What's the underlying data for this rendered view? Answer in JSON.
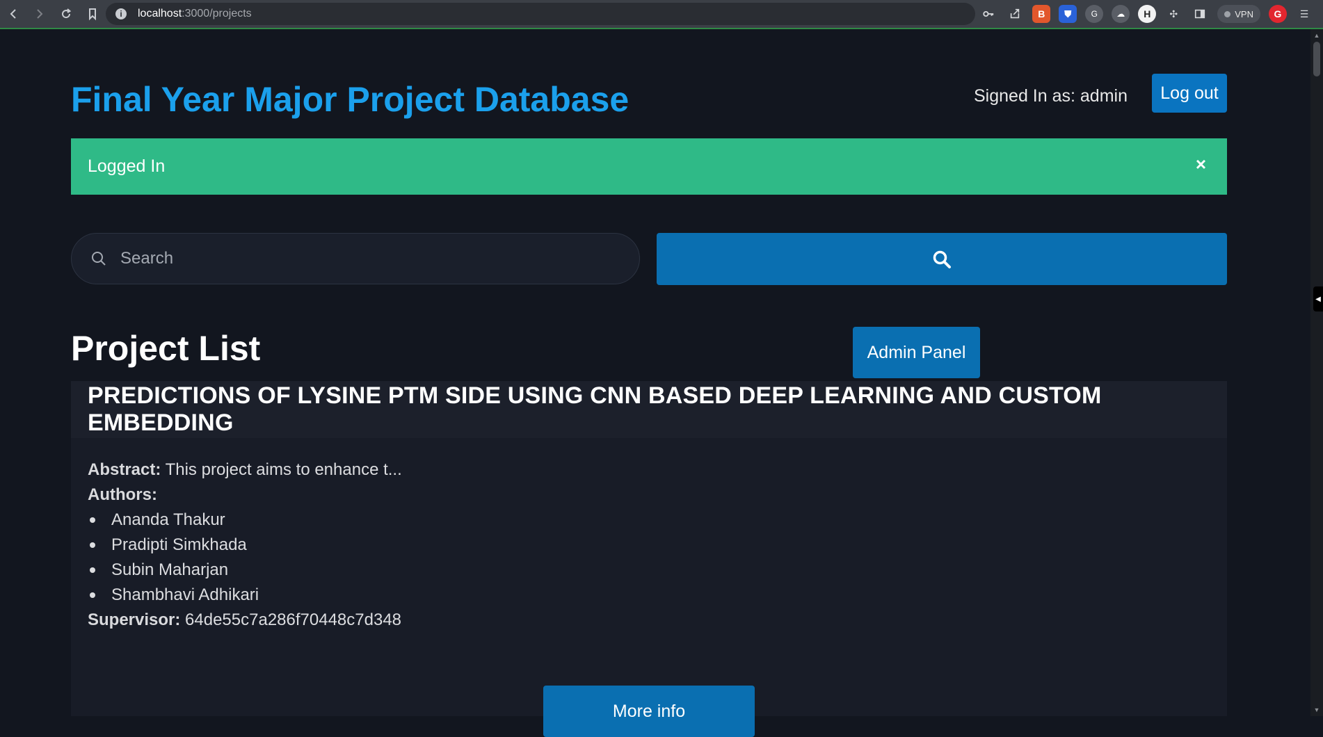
{
  "browser": {
    "url_host": "localhost",
    "url_path": ":3000/projects",
    "vpn_label": "VPN"
  },
  "header": {
    "title": "Final Year Major Project Database",
    "signed_in": "Signed In as: admin",
    "logout_label": "Log out"
  },
  "alert": {
    "message": "Logged In",
    "close": "×"
  },
  "search": {
    "placeholder": "Search"
  },
  "main": {
    "title": "Project List",
    "admin_panel_label": "Admin Panel"
  },
  "project": {
    "title": "PREDICTIONS OF LYSINE PTM SIDE USING CNN BASED DEEP LEARNING AND CUSTOM EMBEDDING",
    "abstract_label": "Abstract:",
    "abstract": " This project aims to enhance t...",
    "authors_label": "Authors:",
    "authors": [
      "Ananda Thakur",
      "Pradipti Simkhada",
      "Subin Maharjan",
      "Shambhavi Adhikari"
    ],
    "supervisor_label": "Supervisor:",
    "supervisor": " 64de55c7a286f70448c7d348",
    "more_info_label": "More info"
  },
  "colors": {
    "title_blue": "#1ba0ec",
    "button_blue": "#0a6fb1",
    "alert_green": "#2fba87",
    "background": "#12161f"
  }
}
